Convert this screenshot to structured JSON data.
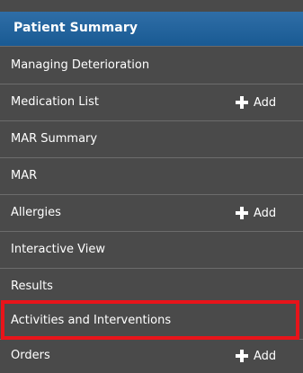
{
  "header": {
    "title": "Patient Summary"
  },
  "items": [
    {
      "label": "Managing Deterioration",
      "add": null
    },
    {
      "label": "Medication List",
      "add": "Add"
    },
    {
      "label": "MAR Summary",
      "add": null
    },
    {
      "label": "MAR",
      "add": null
    },
    {
      "label": "Allergies",
      "add": "Add"
    },
    {
      "label": "Interactive View",
      "add": null
    },
    {
      "label": "Results",
      "add": null
    },
    {
      "label": "Activities and Interventions",
      "add": null,
      "highlighted": true
    },
    {
      "label": "Orders",
      "add": "Add"
    }
  ],
  "colors": {
    "header": "#1d5e98",
    "item_bg": "#4a4a4a",
    "highlight_border": "#e8141a"
  },
  "icons": {
    "add": "plus-icon"
  }
}
